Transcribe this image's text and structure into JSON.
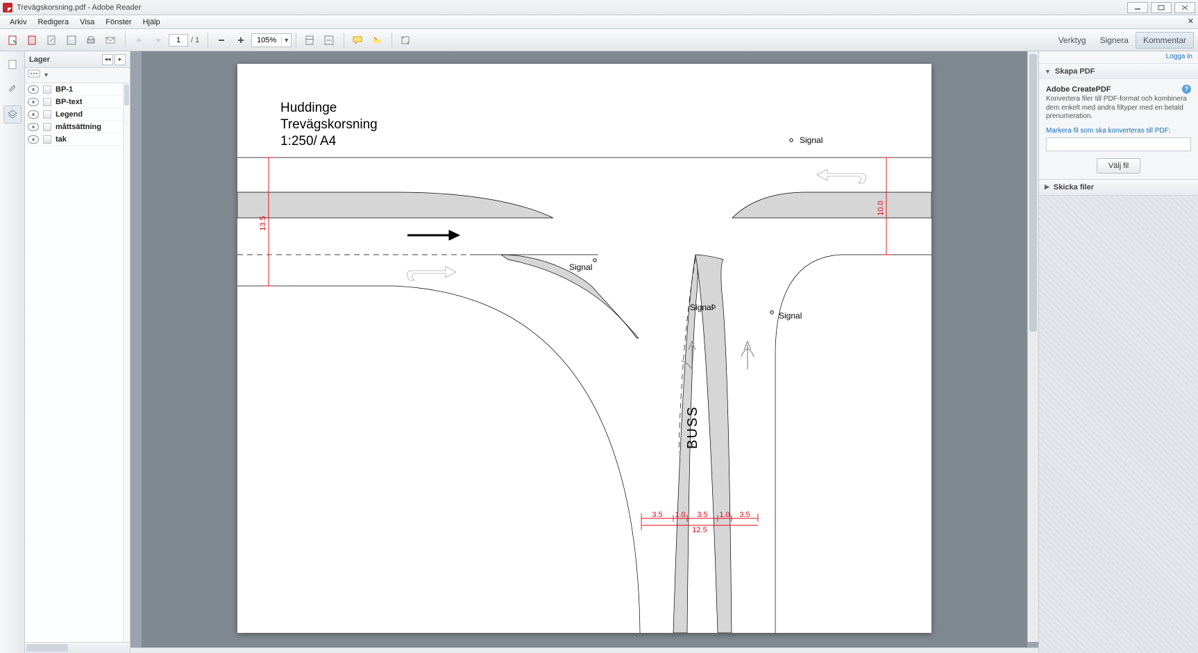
{
  "window": {
    "title": "Trevägskorsning.pdf - Adobe Reader"
  },
  "menu": {
    "items": [
      "Arkiv",
      "Redigera",
      "Visa",
      "Fönster",
      "Hjälp"
    ]
  },
  "toolbar": {
    "page_current": "1",
    "page_total": "/ 1",
    "zoom": "105%",
    "right_buttons": [
      "Verktyg",
      "Signera",
      "Kommentar"
    ],
    "active_right": 2
  },
  "layers_panel": {
    "title": "Lager",
    "items": [
      "BP-1",
      "BP-text",
      "Legend",
      "måttsättning",
      "tak"
    ]
  },
  "document": {
    "title_line1": "Huddinge",
    "title_line2": "Trevägskorsning",
    "title_line3": "1:250/ A4",
    "signal_label": "Signal",
    "buss": "BUSS",
    "dims": {
      "left": "13.5",
      "right": "10.0",
      "b1": "3.5",
      "b2": "1.0",
      "b3": "3.5",
      "b4": "1.0",
      "b5": "3.5",
      "btot": "12.5"
    }
  },
  "rightpanel": {
    "login": "Logga in",
    "section1": {
      "title": "Skapa PDF",
      "heading": "Adobe CreatePDF",
      "desc": "Konvertera filer till PDF-format och kombinera dem enkelt med andra filtyper med en betald prenumeration.",
      "select_label": "Markera fil som ska konverteras till PDF:",
      "button": "Välj fil"
    },
    "section2": {
      "title": "Skicka filer"
    }
  }
}
